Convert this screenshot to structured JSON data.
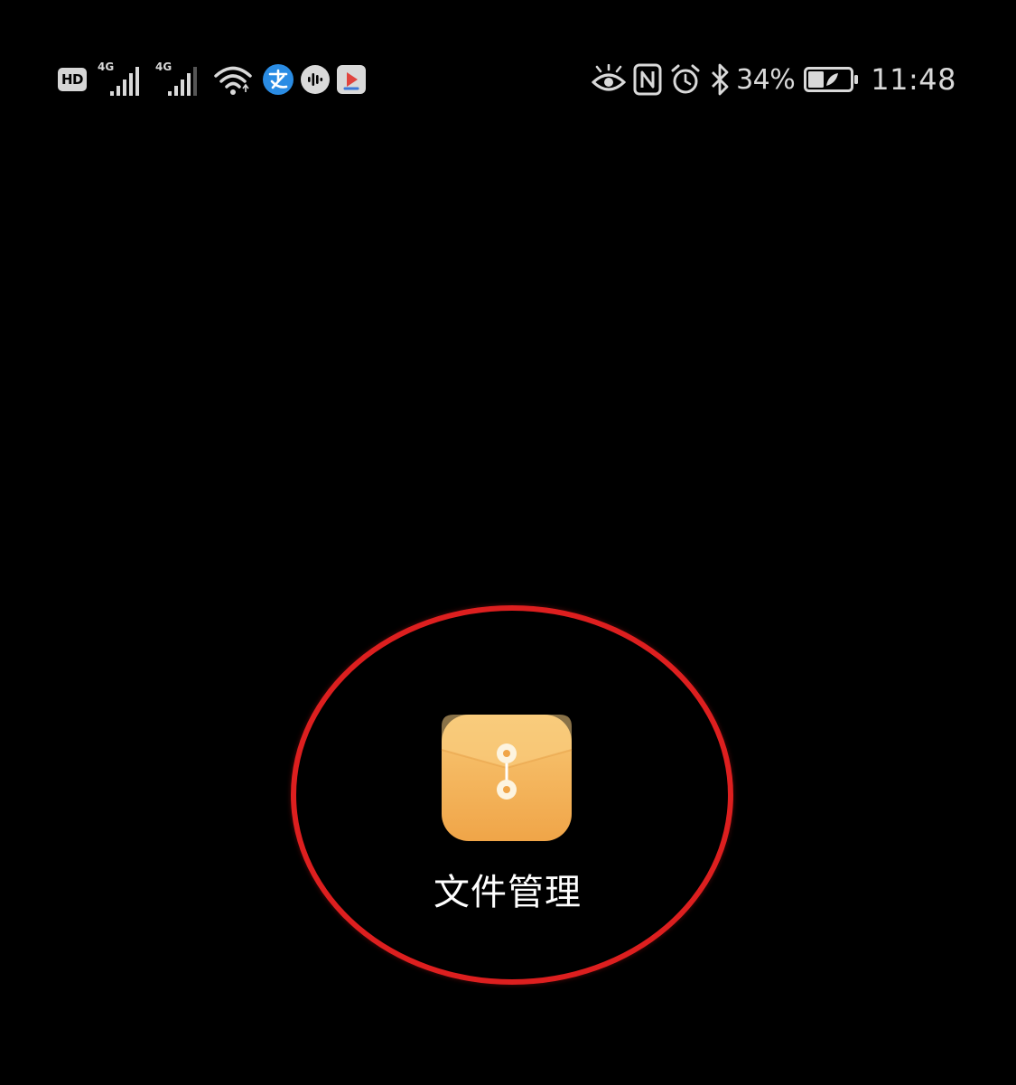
{
  "status_bar": {
    "left": {
      "hd_label": "HD",
      "sim1": {
        "network": "4G"
      },
      "sim2": {
        "network": "4G"
      },
      "icons": [
        "wifi-icon",
        "alipay-icon",
        "voice-assistant-icon",
        "video-app-icon"
      ]
    },
    "right": {
      "icons": [
        "eye-comfort-icon",
        "nfc-icon",
        "alarm-icon",
        "bluetooth-icon"
      ],
      "battery_percent": "34%",
      "time": "11:48"
    }
  },
  "home_screen": {
    "app": {
      "label": "文件管理",
      "icon": "file-manager-icon"
    },
    "highlight_color": "#dd1f1f"
  },
  "colors": {
    "background": "#000000",
    "status_text": "#d9d9d9",
    "app_icon_top": "#f8c774",
    "app_icon_bottom": "#f0a548",
    "alipay_blue": "#2a8ce4"
  }
}
